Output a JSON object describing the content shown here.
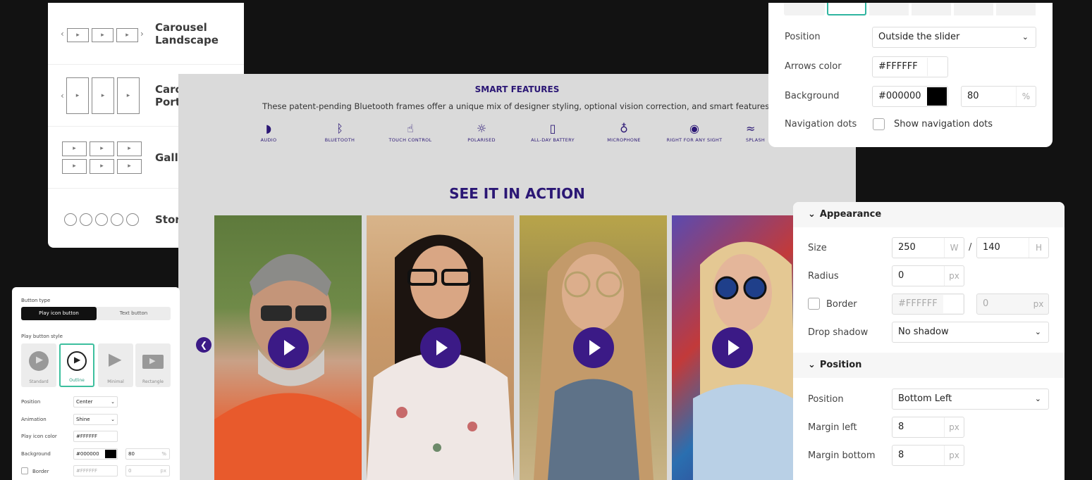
{
  "layouts": [
    {
      "label": "Carousel\nLandscape"
    },
    {
      "label": "Carousel\nPortrait"
    },
    {
      "label": "Gallery Grid"
    },
    {
      "label": "Story"
    }
  ],
  "preview": {
    "features_title": "SMART FEATURES",
    "features_desc": "These patent-pending Bluetooth frames offer a unique mix of designer styling, optional vision correction, and smart features.",
    "features": [
      {
        "label": "AUDIO",
        "icon": "ear-icon"
      },
      {
        "label": "BLUETOOTH",
        "icon": "bluetooth-icon"
      },
      {
        "label": "TOUCH CONTROL",
        "icon": "hand-icon"
      },
      {
        "label": "POLARISED",
        "icon": "sun-icon"
      },
      {
        "label": "ALL-DAY BATTERY",
        "icon": "battery-icon"
      },
      {
        "label": "MICROPHONE",
        "icon": "microphone-icon"
      },
      {
        "label": "RIGHT FOR ANY SIGHT",
        "icon": "eye-icon"
      },
      {
        "label": "SPLASH",
        "icon": "splash-icon"
      }
    ],
    "section_title": "SEE IT IN ACTION",
    "accent": "#3b1a86",
    "title_color": "#2b1775"
  },
  "arrows": {
    "position_label": "Position",
    "position_value": "Outside the slider",
    "arrows_color_label": "Arrows color",
    "arrows_color_value": "#FFFFFF",
    "background_label": "Background",
    "background_value": "#000000",
    "background_opacity": "80",
    "percent_unit": "%",
    "nav_dots_label": "Navigation dots",
    "nav_dots_checkbox": "Show navigation dots"
  },
  "appearance": {
    "section_label": "Appearance",
    "size_label": "Size",
    "width": "250",
    "width_unit": "W",
    "slash": "/",
    "height": "140",
    "height_unit": "H",
    "radius_label": "Radius",
    "radius": "0",
    "px": "px",
    "border_label": "Border",
    "border_color": "#FFFFFF",
    "border_width": "0",
    "shadow_label": "Drop shadow",
    "shadow_value": "No shadow",
    "position_section": "Position",
    "position_label": "Position",
    "position_value": "Bottom Left",
    "margin_left_label": "Margin left",
    "margin_left": "8",
    "margin_bottom_label": "Margin bottom",
    "margin_bottom": "8"
  },
  "button_panel": {
    "button_type_label": "Button type",
    "tab_play": "Play icon button",
    "tab_text": "Text button",
    "style_label": "Play button style",
    "styles": [
      "Standard",
      "Outline",
      "Minimal",
      "Rectangle"
    ],
    "position_label": "Position",
    "position_value": "Center",
    "animation_label": "Animation",
    "animation_value": "Shine",
    "icon_color_label": "Play icon color",
    "icon_color_value": "#FFFFFF",
    "background_label": "Background",
    "background_value": "#000000",
    "background_opacity": "80",
    "percent": "%",
    "border_label": "Border",
    "border_color": "#FFFFFF",
    "border_width": "0",
    "px": "px"
  }
}
